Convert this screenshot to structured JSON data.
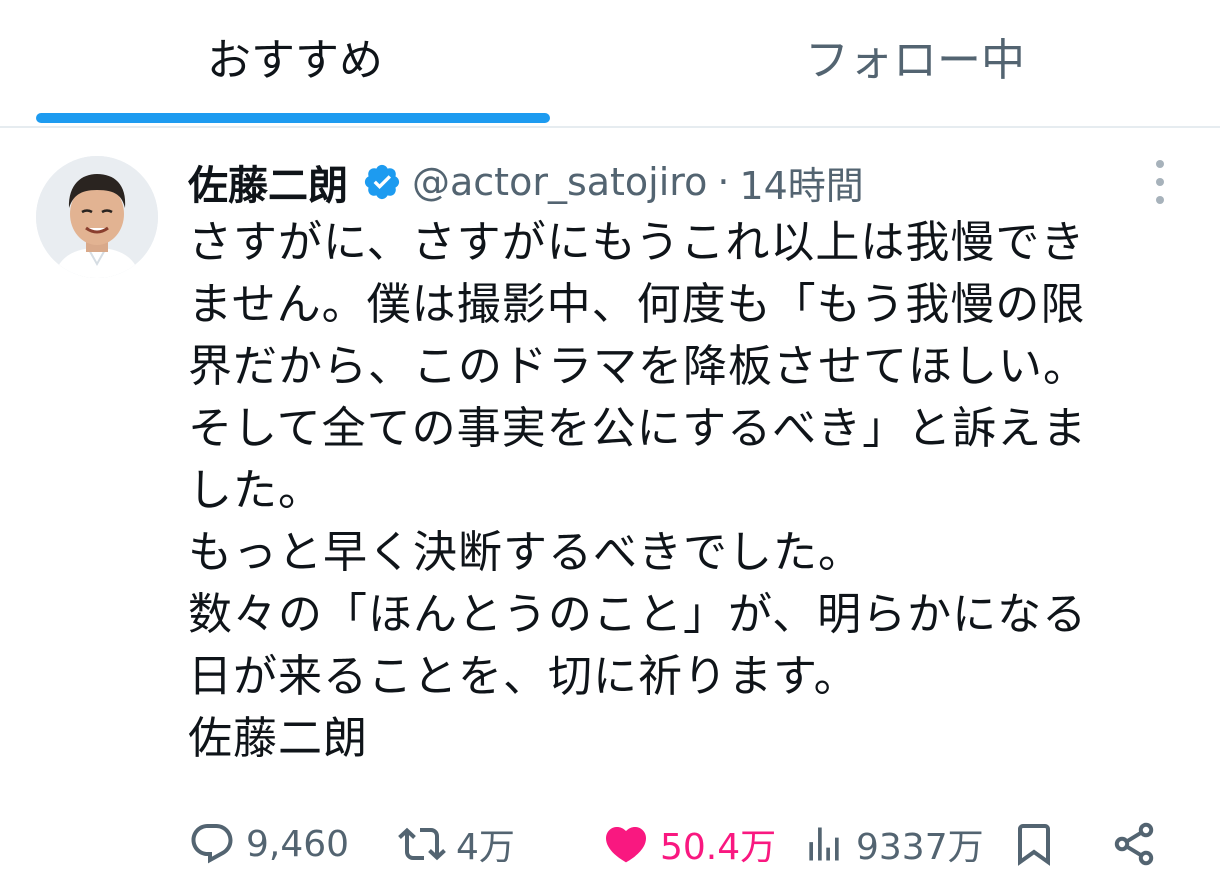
{
  "tabs": {
    "home_label": "おすすめ",
    "following_label": "フォロー中"
  },
  "tweet": {
    "display_name": "佐藤二朗",
    "handle": "@actor_satojiro",
    "separator": "·",
    "time": "14時間",
    "lines": [
      "さすがに、さすがにもうこれ以上は我慢でき",
      "ません。僕は撮影中、何度も「もう我慢の限",
      "界だから、このドラマを降板させてほしい。",
      "そして全ての事実を公にするべき」と訴えま",
      "した。",
      "もっと早く決断するべきでした。",
      "数々の「ほんとうのこと」が、明らかになる",
      "日が来ることを、切に祈ります。",
      "佐藤二朗"
    ],
    "verified_icon": "verified-badge-icon"
  },
  "actions": {
    "replies": "9,460",
    "retweets": "4万",
    "likes": "50.4万",
    "views": "9337万"
  },
  "colors": {
    "accent": "#1d9bf0",
    "like": "#f91880",
    "muted": "#536471",
    "text": "#0f1419"
  }
}
